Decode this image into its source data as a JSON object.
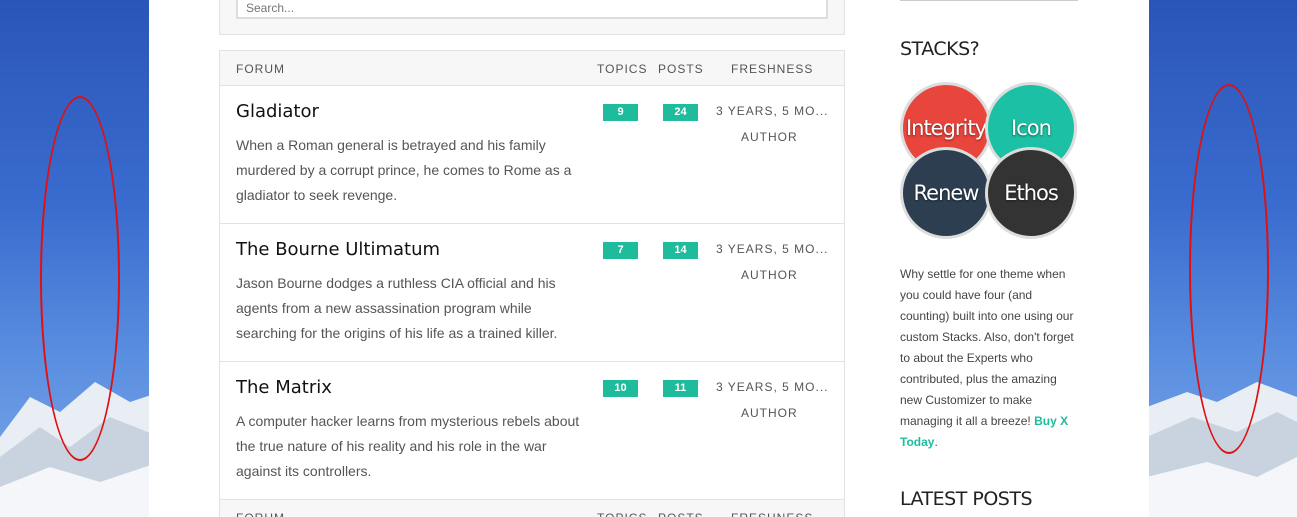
{
  "search": {
    "placeholder": "Search..."
  },
  "table": {
    "headers": {
      "forum": "FORUM",
      "topics": "TOPICS",
      "posts": "POSTS",
      "freshness": "FRESHNESS"
    },
    "rows": [
      {
        "title": "Gladiator",
        "description": "When a Roman general is betrayed and his family murdered by a corrupt prince, he comes to Rome as a gladiator to seek revenge.",
        "topics": "9",
        "posts": "24",
        "freshness": "3 YEARS, 5 MO...",
        "author": "AUTHOR"
      },
      {
        "title": "The Bourne Ultimatum",
        "description": "Jason Bourne dodges a ruthless CIA official and his agents from a new assassination program while searching for the origins of his life as a trained killer.",
        "topics": "7",
        "posts": "14",
        "freshness": "3 YEARS, 5 MO...",
        "author": "AUTHOR"
      },
      {
        "title": "The Matrix",
        "description": "A computer hacker learns from mysterious rebels about the true nature of his reality and his role in the war against its controllers.",
        "topics": "10",
        "posts": "11",
        "freshness": "3 YEARS, 5 MO...",
        "author": "AUTHOR"
      }
    ]
  },
  "sidebar": {
    "stacks_title": "STACKS?",
    "circles": [
      "Integrity",
      "Icon",
      "Renew",
      "Ethos"
    ],
    "text": "Why settle for one theme when you could have four (and counting) built into one using our custom Stacks. Also, don't forget to about the Experts who contributed, plus the amazing new Customizer to make managing it all a breeze!",
    "buy_link": "Buy X Today",
    "trailing": ".",
    "latest_title": "LATEST POSTS"
  },
  "colors": {
    "accent": "#1ebc9c",
    "annotation": "#e01010"
  }
}
